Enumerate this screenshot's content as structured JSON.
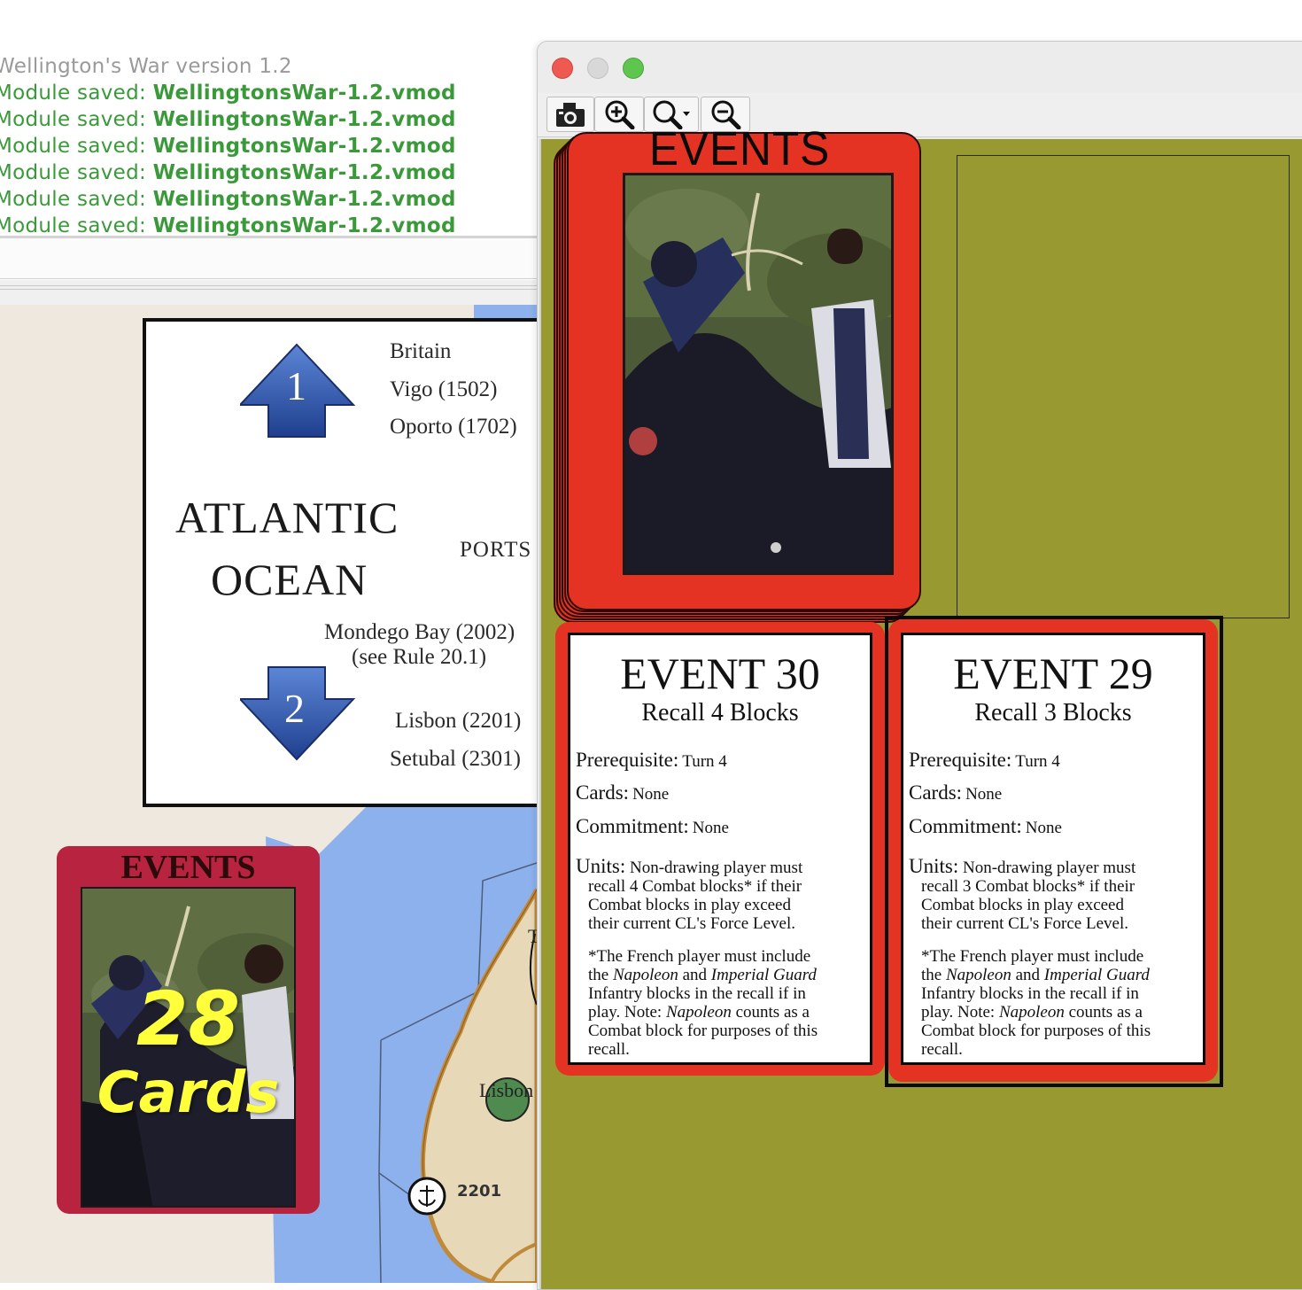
{
  "chat_log": {
    "version_line": "Wellington's War version 1.2",
    "saved_prefix": "Module saved: ",
    "saved_file": "WellingtonsWar-1.2.vmod",
    "saved_count": 6
  },
  "map": {
    "ocean_title_1": "ATLANTIC",
    "ocean_title_2": "OCEAN",
    "ports_label": "PORTS",
    "arrow_1": "1",
    "arrow_2": "2",
    "ports_north": [
      "Britain",
      "Vigo (1502)",
      "Oporto (1702)"
    ],
    "mondego": "Mondego Bay (2002)",
    "mondego_note": "(see Rule 20.1)",
    "ports_south": [
      "Lisbon (2201)",
      "Setubal (2301)"
    ],
    "city_label": "Lisbon",
    "hex_number": "2201",
    "partial_letter": "T",
    "deck": {
      "title": "EVENTS",
      "count": "28",
      "count_label": "Cards"
    }
  },
  "window": {
    "toolbar": {
      "camera": "camera-icon",
      "zoom_in": "zoom-in-icon",
      "zoom_menu": "zoom-menu-icon",
      "zoom_out": "zoom-out-icon"
    },
    "board_deck_title": "EVENTS",
    "colors": {
      "board": "#989930",
      "card_red": "#e43223",
      "close": "#ee5a52",
      "minimize": "#d8d8d8",
      "maximize": "#5ec64e"
    }
  },
  "cards": [
    {
      "title": "EVENT 30",
      "subtitle": "Recall 4 Blocks",
      "prereq_label": "Prerequisite:",
      "prereq_value": "Turn 4",
      "cards_label": "Cards:",
      "cards_value": "None",
      "commit_label": "Commitment:",
      "commit_value": "None",
      "units_label": "Units:",
      "units_first": "Non-drawing player must",
      "units_lines": [
        "recall 4 Combat blocks* if their",
        "Combat blocks in play exceed",
        "their current CL's Force Level."
      ],
      "note_line1": "*The French player must include",
      "note_the": "the",
      "note_napoleon": "Napoleon",
      "note_and": "and",
      "note_guard": "Imperial Guard",
      "note_line3": "Infantry blocks in the recall if in",
      "note_play": "play. Note:",
      "note_napoleon2": "Napoleon",
      "note_counts": "counts as a",
      "note_line5": "Combat block for purposes of this",
      "note_line6": "recall."
    },
    {
      "title": "EVENT 29",
      "subtitle": "Recall 3 Blocks",
      "prereq_label": "Prerequisite:",
      "prereq_value": "Turn 4",
      "cards_label": "Cards:",
      "cards_value": "None",
      "commit_label": "Commitment:",
      "commit_value": "None",
      "units_label": "Units:",
      "units_first": "Non-drawing player must",
      "units_lines": [
        "recall 3 Combat blocks* if their",
        "Combat blocks in play exceed",
        "their current CL's Force Level."
      ],
      "note_line1": "*The French player must include",
      "note_the": "the",
      "note_napoleon": "Napoleon",
      "note_and": "and",
      "note_guard": "Imperial Guard",
      "note_line3": "Infantry blocks in the recall if in",
      "note_play": "play. Note:",
      "note_napoleon2": "Napoleon",
      "note_counts": "counts as a",
      "note_line5": "Combat block for purposes of this",
      "note_line6": "recall."
    }
  ]
}
